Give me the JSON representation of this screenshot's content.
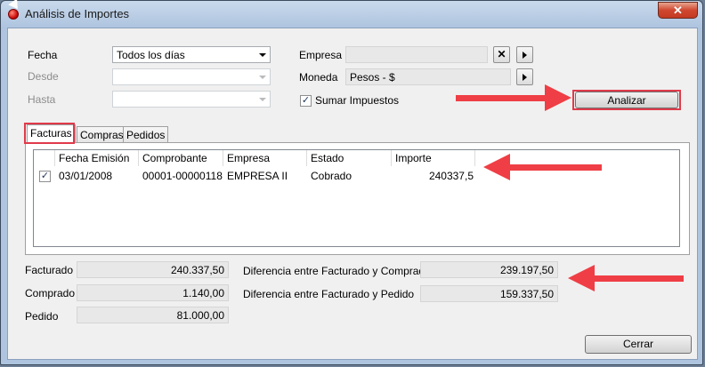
{
  "window": {
    "title": "Análisis de Importes",
    "close_glyph": "✕"
  },
  "form": {
    "fecha_label": "Fecha",
    "fecha_value": "Todos los días",
    "desde_label": "Desde",
    "hasta_label": "Hasta",
    "empresa_label": "Empresa",
    "empresa_value": "",
    "empresa_clear_glyph": "✕",
    "moneda_label": "Moneda",
    "moneda_value": "Pesos - $",
    "sumar_impuestos_label": "Sumar Impuestos",
    "sumar_impuestos_checked": true,
    "check_glyph": "✓",
    "analizar_label": "Analizar"
  },
  "tabs": [
    {
      "label": "Facturas",
      "active": true
    },
    {
      "label": "Compras",
      "active": false
    },
    {
      "label": "Pedidos",
      "active": false
    }
  ],
  "table": {
    "columns": [
      "Fecha Emisión",
      "Comprobante",
      "Empresa",
      "Estado",
      "Importe"
    ],
    "rows": [
      {
        "checked": true,
        "cells": [
          "03/01/2008",
          "00001-00000118",
          "EMPRESA II",
          "Cobrado",
          "240337,5"
        ]
      }
    ]
  },
  "summary": {
    "facturado_label": "Facturado",
    "facturado_value": "240.337,50",
    "comprado_label": "Comprado",
    "comprado_value": "1.140,00",
    "pedido_label": "Pedido",
    "pedido_value": "81.000,00",
    "dif_compra_label": "Diferencia entre Facturado y Comprado",
    "dif_compra_value": "239.197,50",
    "dif_pedido_label": "Diferencia entre Facturado y Pedido",
    "dif_pedido_value": "159.337,50"
  },
  "footer": {
    "cerrar_label": "Cerrar"
  },
  "colors": {
    "annotation_red": "#ef3e45",
    "window_frame": "#aec4df"
  }
}
